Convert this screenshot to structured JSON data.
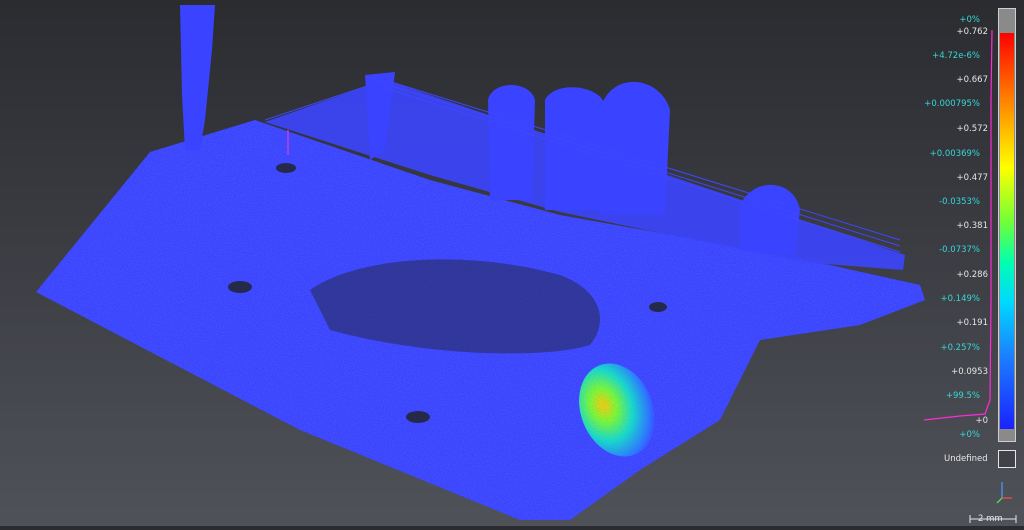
{
  "viewer": {
    "background_top": "#2b2c30",
    "background_bottom": "#4f5258",
    "point_cloud_color": "#3a43ff",
    "scale": {
      "bottom_pct": "+0%",
      "top_pct": "+0%",
      "percent_labels": [
        "+4.72e-6%",
        "+0.000795%",
        "+0.00369%",
        "-0.0353%",
        "-0.0737%",
        "+0.149%",
        "+0.257%",
        "+99.5%"
      ],
      "value_labels": [
        "+0.762",
        "+0.667",
        "+0.572",
        "+0.477",
        "+0.381",
        "+0.286",
        "+0.191",
        "+0.0953",
        "+0"
      ],
      "gradient_colors": [
        "#ff0000",
        "#ff8a00",
        "#ffff00",
        "#6cff3a",
        "#00ffb0",
        "#00d8ff",
        "#1c7dff",
        "#1a22ff"
      ],
      "undefined_label": "Undefined"
    },
    "scale_label": "2 mm",
    "axes": {
      "z": "z",
      "x": "x",
      "y": "y"
    }
  }
}
